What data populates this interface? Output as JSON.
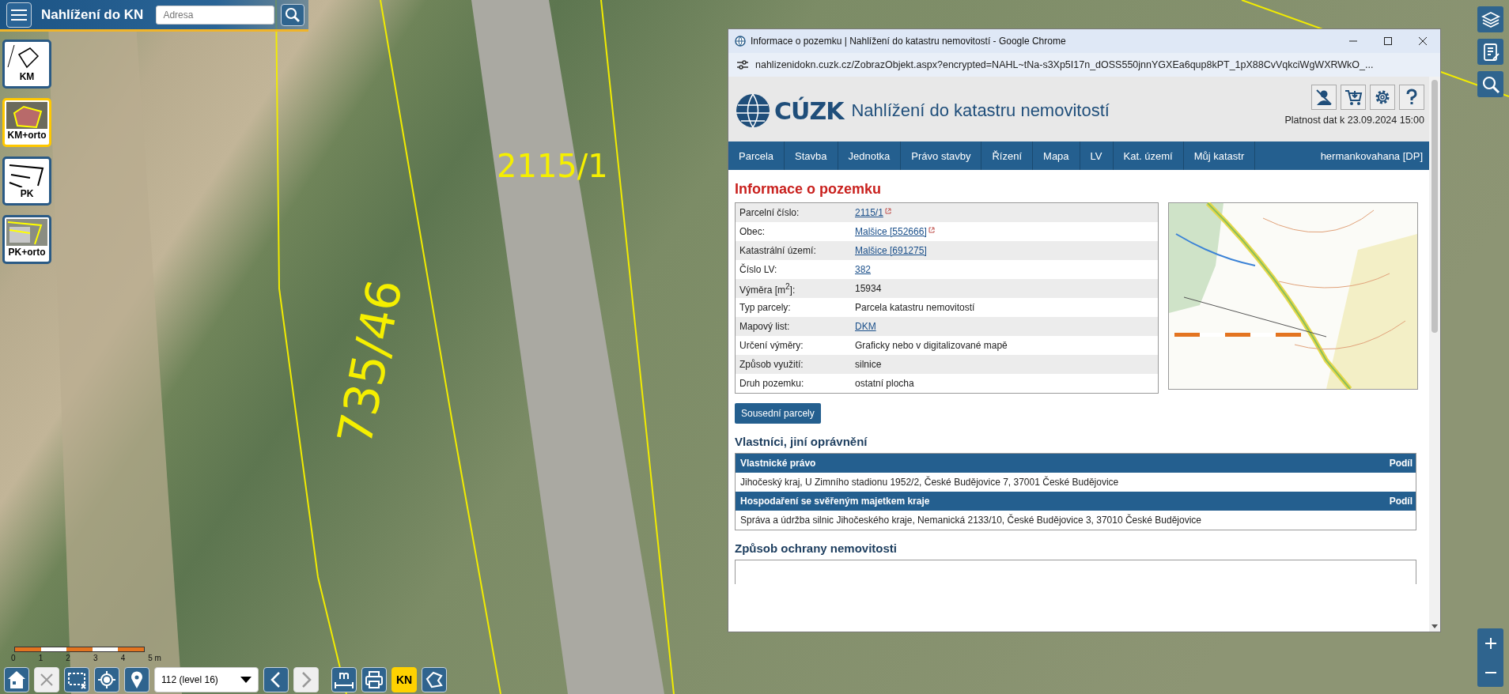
{
  "app_bar": {
    "title": "Nahlížení do KN",
    "search": {
      "placeholder": "Adresa"
    }
  },
  "map_layers": [
    {
      "kind": "km",
      "label": "KM",
      "selected": false
    },
    {
      "kind": "km-orto",
      "label": "KM+orto",
      "selected": true
    },
    {
      "kind": "pk",
      "label": "PK",
      "selected": false
    },
    {
      "kind": "pk-orto",
      "label": "PK+orto",
      "selected": false
    }
  ],
  "map": {
    "parcel_labels": [
      {
        "kind": "horizontal",
        "text": "2115/1"
      },
      {
        "kind": "rotated",
        "text": "735/46"
      }
    ]
  },
  "scale_bar": {
    "ticks": [
      "0",
      "1",
      "2",
      "3",
      "4",
      "5 m"
    ]
  },
  "bottom_toolbar": [
    {
      "kind": "home",
      "disabled": false
    },
    {
      "kind": "clear",
      "disabled": true
    },
    {
      "kind": "select-area",
      "disabled": false
    },
    {
      "kind": "locate",
      "disabled": false
    },
    {
      "kind": "pin",
      "disabled": false
    },
    {
      "kind": "zoom-select",
      "value": "112 (level 16)",
      "disabled": false
    },
    {
      "kind": "prev",
      "disabled": false
    },
    {
      "kind": "next",
      "disabled": true
    },
    {
      "kind": "measure",
      "disabled": false
    },
    {
      "kind": "print",
      "disabled": false
    },
    {
      "kind": "kn",
      "label": "KN",
      "disabled": false
    },
    {
      "kind": "shape",
      "disabled": false
    }
  ],
  "browser_window": {
    "title": "Informace o pozemku | Nahlížení do katastru nemovitostí - Google Chrome",
    "url": "nahlizenidokn.cuzk.cz/ZobrazObjekt.aspx?encrypted=NAHL~tNa-s3Xp5I17n_dOSS550jnnYGXEa6qup8kPT_1pX88CvVqkciWgWXRWkO_..."
  },
  "page": {
    "logo": "CÚZK",
    "site_title": "Nahlížení do katastru nemovitostí",
    "validity": "Platnost dat k 23.09.2024 15:00",
    "nav": [
      "Parcela",
      "Stavba",
      "Jednotka",
      "Právo stavby",
      "Řízení",
      "Mapa",
      "LV",
      "Kat. území",
      "Můj katastr",
      "hermankovahana [DP]"
    ],
    "heading": "Informace o pozemku",
    "parcel_info": [
      {
        "label": "Parcelní číslo:",
        "value": "2115/1",
        "kind": "external-link"
      },
      {
        "label": "Obec:",
        "value": "Malšice [552666]",
        "kind": "external-link"
      },
      {
        "label": "Katastrální území:",
        "value": "Malšice [691275]",
        "kind": "link"
      },
      {
        "label": "Číslo LV:",
        "value": "382",
        "kind": "link"
      },
      {
        "label": "Výměra [m$^{2}$]:",
        "value": "15934",
        "kind": "text"
      },
      {
        "label": "Typ parcely:",
        "value": "Parcela katastru nemovitostí",
        "kind": "text"
      },
      {
        "label": "Mapový list:",
        "value": "DKM",
        "kind": "link"
      },
      {
        "label": "Určení výměry:",
        "value": "Graficky nebo v digitalizované mapě",
        "kind": "text"
      },
      {
        "label": "Způsob využití:",
        "value": "silnice",
        "kind": "text"
      },
      {
        "label": "Druh pozemku:",
        "value": "ostatní plocha",
        "kind": "text"
      }
    ],
    "neighbours_button": "Sousední parcely",
    "owners": {
      "heading": "Vlastníci, jiní oprávnění",
      "groups": [
        {
          "title": "Vlastnické právo",
          "share_header": "Podíl",
          "rows": [
            "Jihočeský kraj, U Zimního stadionu 1952/2, České Budějovice 7, 37001 České Budějovice"
          ]
        },
        {
          "title": "Hospodaření se svěřeným majetkem kraje",
          "share_header": "Podíl",
          "rows": [
            "Správa a údržba silnic Jihočeského kraje, Nemanická 2133/10, České Budějovice 3, 37010 České Budějovice"
          ]
        }
      ]
    },
    "protection": {
      "heading": "Způsob ochrany nemovitosti"
    }
  }
}
